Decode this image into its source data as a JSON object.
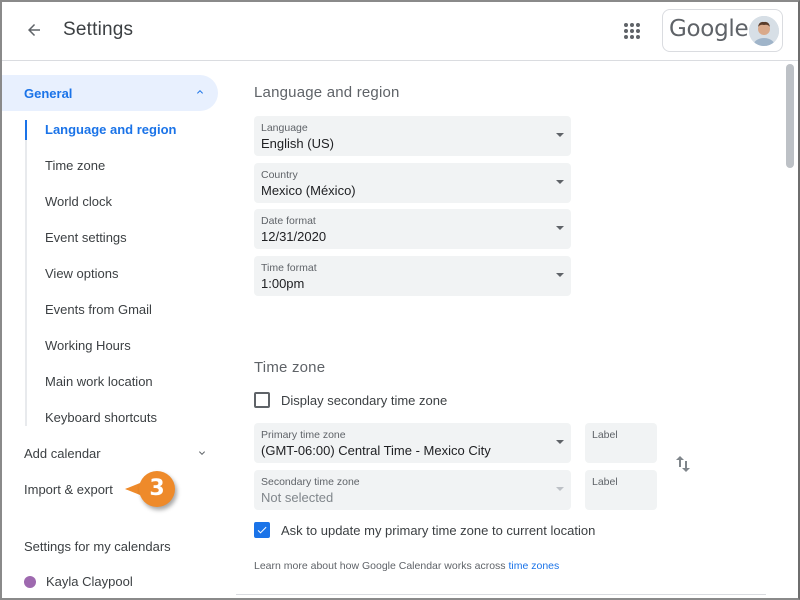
{
  "header": {
    "title": "Settings",
    "back_icon": "arrow-left-icon",
    "apps_icon": "apps-grid-icon",
    "account_brand": "Google"
  },
  "sidebar": {
    "general": {
      "label": "General",
      "expanded": true
    },
    "general_items": [
      {
        "label": "Language and region",
        "active": true
      },
      {
        "label": "Time zone"
      },
      {
        "label": "World clock"
      },
      {
        "label": "Event settings"
      },
      {
        "label": "View options"
      },
      {
        "label": "Events from Gmail"
      },
      {
        "label": "Working Hours"
      },
      {
        "label": "Main work location"
      },
      {
        "label": "Keyboard shortcuts"
      }
    ],
    "add_calendar": "Add calendar",
    "import_export": "Import & export",
    "my_calendars_heading": "Settings for my calendars",
    "calendars": [
      {
        "name": "Kayla Claypool",
        "color": "#9e69af"
      }
    ]
  },
  "callout": {
    "number": "3",
    "color": "#ee8a2a"
  },
  "language_region": {
    "heading": "Language and region",
    "language": {
      "label": "Language",
      "value": "English (US)"
    },
    "country": {
      "label": "Country",
      "value": "Mexico (México)"
    },
    "date_format": {
      "label": "Date format",
      "value": "12/31/2020"
    },
    "time_format": {
      "label": "Time format",
      "value": "1:00pm"
    }
  },
  "time_zone": {
    "heading": "Time zone",
    "display_secondary": {
      "label": "Display secondary time zone",
      "checked": false
    },
    "primary": {
      "label": "Primary time zone",
      "value": "(GMT-06:00) Central Time - Mexico City"
    },
    "primary_label": {
      "label": "Label",
      "value": ""
    },
    "secondary": {
      "label": "Secondary time zone",
      "value": "Not selected",
      "disabled": true
    },
    "secondary_label": {
      "label": "Label",
      "value": ""
    },
    "ask_update": {
      "label": "Ask to update my primary time zone to current location",
      "checked": true
    },
    "learn_more_text": "Learn more about how Google Calendar works across",
    "learn_more_link": "time zones"
  },
  "colors": {
    "accent": "#1a73e8",
    "nav_active_bg": "#e8f0fe",
    "field_bg": "#f1f3f4"
  }
}
